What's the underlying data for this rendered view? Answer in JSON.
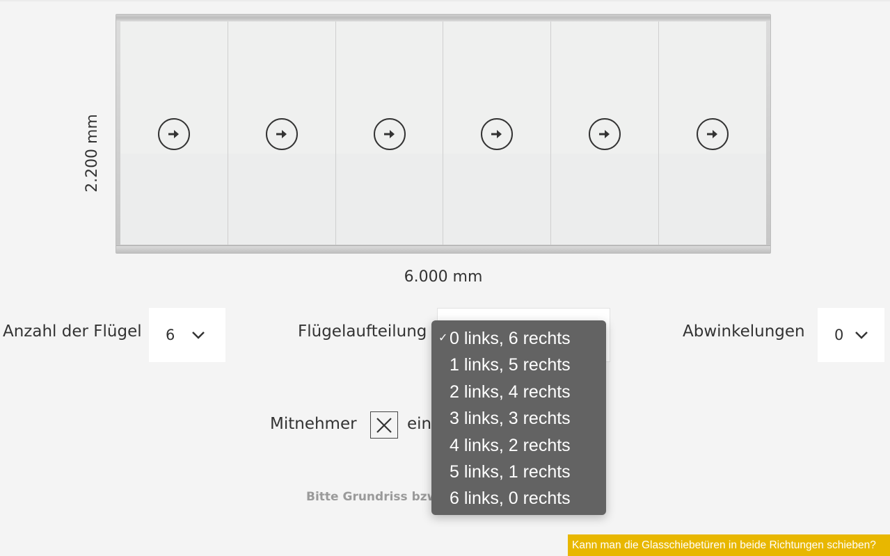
{
  "visual": {
    "height_label": "2.200 mm",
    "width_label": "6.000 mm",
    "panel_count": 6,
    "arrow_direction": "right",
    "arrow_icon": "arrow-right-circle-icon"
  },
  "controls": {
    "wing_count": {
      "label": "Anzahl der Flügel",
      "value": "6"
    },
    "wing_split": {
      "label": "Flügelaufteilung"
    },
    "angles": {
      "label": "Abwinkelungen",
      "value": "0"
    }
  },
  "mitnehmer": {
    "label": "Mitnehmer",
    "suffix": "ein",
    "checked": true
  },
  "hint": {
    "text": "Bitte Grundriss bzw."
  },
  "dropdown": {
    "selected_index": 0,
    "options": [
      "0 links, 6 rechts",
      "1 links, 5 rechts",
      "2 links, 4 rechts",
      "3 links, 3 rechts",
      "4 links, 2 rechts",
      "5 links, 1 rechts",
      "6 links, 0 rechts"
    ]
  },
  "faq_banner": {
    "text": "Kann man die Glasschiebetüren in beide Richtungen schieben?"
  },
  "colors": {
    "background": "#f4f4f4",
    "dropdown_bg": "#636363",
    "banner_bg": "#e8b700",
    "hint_text": "#9a9a9a"
  }
}
